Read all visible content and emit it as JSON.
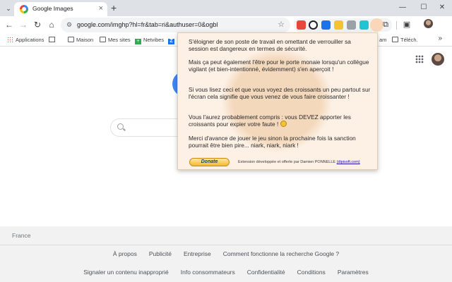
{
  "tabstrip": {
    "menu_glyph": "⌄",
    "tab": {
      "title": "Google Images",
      "close_glyph": "×"
    },
    "new_tab_glyph": "+",
    "window_controls": {
      "minimize": "—",
      "maximize": "☐",
      "close": "✕"
    }
  },
  "toolbar": {
    "back_glyph": "←",
    "forward_glyph": "→",
    "reload_glyph": "↻",
    "home_glyph": "⌂",
    "url": "google.com/imghp?hl=fr&tab=ri&authuser=0&ogbl",
    "star_glyph": "☆",
    "extensions_glyph": "⧉",
    "screenshot_glyph": "▣"
  },
  "bookmarks": {
    "items": [
      "Applications",
      "Maison",
      "Mes sites",
      "Netvibes",
      "am",
      "Téléch."
    ],
    "more_glyph": "»"
  },
  "popup": {
    "p1": "S'éloigner de son poste de travail en omettant de verrouiller sa session est dangereux en termes de sécurité.",
    "p2": "Mais ça peut également l'être pour le porte monaie lorsqu'un collègue vigilant (et bien-intentionné, évidemment) s'en aperçoit !",
    "p3": "Si vous lisez ceci et que vous voyez des croissants un peu partout sur l'écran cela signifie que vous venez de vous faire croissanter !",
    "p4": "Vous l'aurez probablement compris : vous DEVEZ apporter les croissants pour expier votre faute !",
    "p5": "Merci d'avance de jouer le jeu sinon la prochaine fois la sanction pourrait être bien pire... niark, niark, niark !",
    "donate_label": "Donate",
    "credit_text": "Extension développée et offerte par Damien PONNELLE",
    "credit_link": "(dipisoft.com)"
  },
  "footer": {
    "country": "France",
    "row1": [
      "À propos",
      "Publicité",
      "Entreprise",
      "Comment fonctionne la recherche Google ?"
    ],
    "row2": [
      "Signaler un contenu inapproprié",
      "Info consommateurs",
      "Confidentialité",
      "Conditions",
      "Paramètres"
    ]
  },
  "colors": {
    "popup_bg": "#fdf1e6",
    "tabstrip_bg": "#dee1e6",
    "footer_bg": "#f2f2f2",
    "google_blue": "#4285f4"
  }
}
